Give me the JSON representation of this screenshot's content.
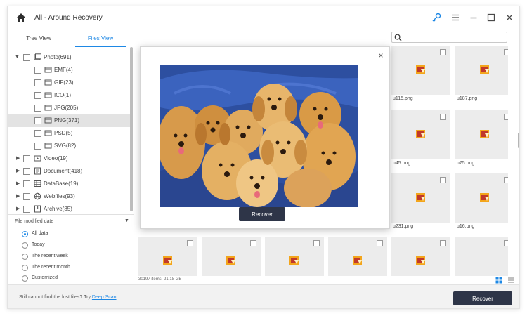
{
  "window": {
    "title": "All - Around Recovery"
  },
  "titlebar_icons": [
    "home-icon",
    "key-icon",
    "menu-icon",
    "minimize-icon",
    "maximize-icon",
    "close-icon"
  ],
  "tabs": [
    {
      "label": "Tree View",
      "active": false
    },
    {
      "label": "Files View",
      "active": true
    }
  ],
  "search": {
    "value": "",
    "placeholder": ""
  },
  "tree": {
    "items": [
      {
        "label": "Photo(691)",
        "icon": "photo-icon",
        "level": 0,
        "expanded": true
      },
      {
        "label": "EMF(4)",
        "icon": "folder-icon",
        "level": 1
      },
      {
        "label": "GIF(23)",
        "icon": "folder-icon",
        "level": 1
      },
      {
        "label": "ICO(1)",
        "icon": "folder-icon",
        "level": 1
      },
      {
        "label": "JPG(205)",
        "icon": "folder-icon",
        "level": 1
      },
      {
        "label": "PNG(371)",
        "icon": "folder-icon",
        "level": 1,
        "selected": true
      },
      {
        "label": "PSD(5)",
        "icon": "folder-icon",
        "level": 1
      },
      {
        "label": "SVG(82)",
        "icon": "folder-icon",
        "level": 1
      },
      {
        "label": "Video(19)",
        "icon": "video-icon",
        "level": 0
      },
      {
        "label": "Document(418)",
        "icon": "document-icon",
        "level": 0
      },
      {
        "label": "DataBase(19)",
        "icon": "database-icon",
        "level": 0
      },
      {
        "label": "Webfiles(93)",
        "icon": "globe-icon",
        "level": 0
      },
      {
        "label": "Archive(85)",
        "icon": "archive-icon",
        "level": 0
      }
    ]
  },
  "filter": {
    "header": "File modified date",
    "options": [
      {
        "label": "All data",
        "selected": true
      },
      {
        "label": "Today",
        "selected": false
      },
      {
        "label": "The recent week",
        "selected": false
      },
      {
        "label": "The recent month",
        "selected": false
      },
      {
        "label": "Customized",
        "selected": false
      }
    ]
  },
  "grid": {
    "files": [
      {
        "name": "u115.png"
      },
      {
        "name": "u187.png"
      },
      {
        "name": "u45.png"
      },
      {
        "name": "u75.png"
      },
      {
        "name": "u231.png"
      },
      {
        "name": "u16.png"
      },
      {
        "name": ""
      },
      {
        "name": ""
      },
      {
        "name": ""
      },
      {
        "name": ""
      },
      {
        "name": ""
      },
      {
        "name": ""
      }
    ]
  },
  "status": {
    "text": "30197 items, 21.18 GB"
  },
  "modal": {
    "recover_label": "Recover",
    "image": "golden-retriever-puppies"
  },
  "bottom": {
    "hint": "Still cannot find the lost files? Try ",
    "deep_scan": "Deep Scan",
    "recover_label": "Recover"
  },
  "colors": {
    "accent": "#1e88e5",
    "button_dark": "#2e3548",
    "selected_row": "#e3e3e3"
  }
}
